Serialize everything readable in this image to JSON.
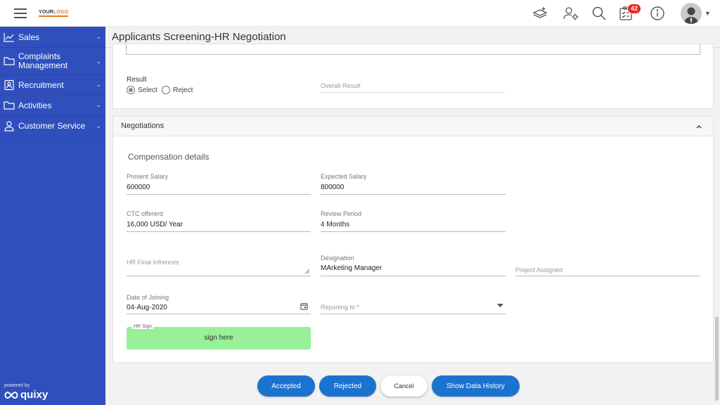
{
  "logo": {
    "pre": "YOUR",
    "post": "LOGO"
  },
  "topbar": {
    "notification_count": "42"
  },
  "sidebar": {
    "items": [
      {
        "label": "Sales",
        "icon": "trend-chart-icon"
      },
      {
        "label": "Complaints Management",
        "icon": "folder-icon"
      },
      {
        "label": "Recruitment",
        "icon": "id-card-icon"
      },
      {
        "label": "Activities",
        "icon": "folder-icon"
      },
      {
        "label": "Customer Service",
        "icon": "person-icon"
      }
    ],
    "powered_by": "powered by",
    "brand": "quixy"
  },
  "page": {
    "title": "Applicants Screening-HR Negotiation"
  },
  "result": {
    "label": "Result",
    "option_select": "Select",
    "option_reject": "Reject",
    "selected": "Select",
    "overall_placeholder": "Overall Result"
  },
  "negotiations": {
    "title": "Negotiations",
    "section_title": "Compensation details",
    "present_salary": {
      "label": "Present Salary",
      "value": "600000"
    },
    "expected_salary": {
      "label": "Expected Salary",
      "value": "800000"
    },
    "ctc_offered": {
      "label": "CTC offererd",
      "value": "16,000 USD/ Year"
    },
    "review_period": {
      "label": "Review Period",
      "value": "4 Months"
    },
    "hr_final_inferences": {
      "placeholder": "HR Final Infrences"
    },
    "designation": {
      "label": "Designation",
      "value": "MArketing Manager"
    },
    "project_assigned": {
      "placeholder": "Project Assigned"
    },
    "date_of_joining": {
      "label": "Date of Joining",
      "value": "04-Aug-2020"
    },
    "reporting_to": {
      "placeholder": "Reporting to *"
    },
    "hr_sign": {
      "label": "HR Sign",
      "hint": "sign here"
    }
  },
  "actions": {
    "accepted": "Accepted",
    "rejected": "Rejected",
    "cancel": "Cancel",
    "history": "Show Data History"
  },
  "colors": {
    "sidebar": "#2f4fbd",
    "primary_button": "#1a73cf",
    "sign_pad": "#98f098",
    "badge": "#e8251f",
    "logo_accent": "#e87b1e"
  }
}
